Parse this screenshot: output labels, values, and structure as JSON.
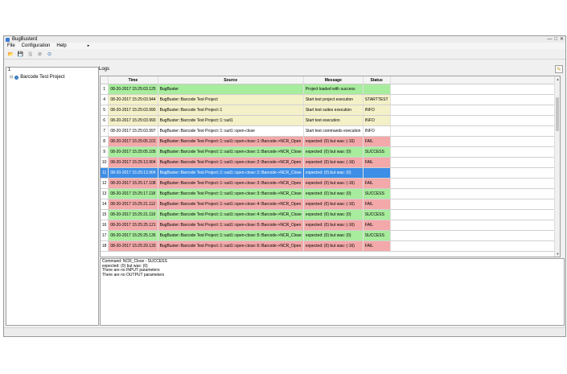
{
  "window": {
    "title": "BugBusterd",
    "controls": {
      "minimize": "—",
      "maximize": "□",
      "close": "✕"
    }
  },
  "menu": {
    "file": "File",
    "configuration": "Configuration",
    "help": "Help",
    "arrow": "▸"
  },
  "toolbar": {
    "icons": {
      "open": "📂",
      "save": "💾",
      "save_all": "🖫",
      "stop": "⊘",
      "run": "⊙"
    }
  },
  "tree": {
    "index": "1",
    "expander": "⊟",
    "project_label": "Barcode Test Project"
  },
  "logs": {
    "label": "Logs",
    "clear_icon": "✎",
    "columns": {
      "time": "Time",
      "source": "Source",
      "message": "Message",
      "status": "Status"
    },
    "rows": [
      {
        "idx": "1",
        "time": "08-20-2017 15:25:03.125",
        "source": "BugBuster",
        "message": "Project loaded with success",
        "status": "",
        "color": "green"
      },
      {
        "idx": "4",
        "time": "08-20-2017 15:25:03.944",
        "source": "BugBuster::Barcode Test Project",
        "message": "Start test project execution",
        "status": "STARTTEST",
        "color": "yellow"
      },
      {
        "idx": "5",
        "time": "08-20-2017 15:25:03.990",
        "source": "BugBuster::Barcode Test Project::1",
        "message": "Start test suites execution",
        "status": "INFO",
        "color": "yellow"
      },
      {
        "idx": "6",
        "time": "08-20-2017 15:25:03.993",
        "source": "BugBuster::Barcode Test Project::1::suit1",
        "message": "Start test execution",
        "status": "INFO",
        "color": "yellow"
      },
      {
        "idx": "7",
        "time": "08-20-2017 15:25:03.997",
        "source": "BugBuster::Barcode Test Project::1::suit1::open-close",
        "message": "Start test commands execution",
        "status": "INFO",
        "color": "white"
      },
      {
        "idx": "8",
        "time": "08-20-2017 15:25:05.101",
        "source": "BugBuster::Barcode Test Project::1::suit1::open-close::1::Barcode->NCR_Open",
        "message": "expected: (0) but was: (-16)",
        "status": "FAIL",
        "color": "red"
      },
      {
        "idx": "9",
        "time": "08-20-2017 15:25:05.105",
        "source": "BugBuster::Barcode Test Project::1::suit1::open-close::1::Barcode->NCR_Close",
        "message": "expected: (0) but was: (0)",
        "status": "SUCCESS",
        "color": "green"
      },
      {
        "idx": "10",
        "time": "08-20-2017 15:25:13.904",
        "source": "BugBuster::Barcode Test Project::1::suit1::open-close::2::Barcode->NCR_Open",
        "message": "expected: (0) but was: (-16)",
        "status": "FAIL",
        "color": "red"
      },
      {
        "idx": "11",
        "time": "08-20-2017 15:25:13.904",
        "source": "BugBuster::Barcode Test Project::1::suit1::open-close::2::Barcode->NCR_Close",
        "message": "expected: (0) but was: (0)",
        "status": "",
        "color": "selected"
      },
      {
        "idx": "12",
        "time": "08-20-2017 15:25:17.108",
        "source": "BugBuster::Barcode Test Project::1::suit1::open-close::3::Barcode->NCR_Open",
        "message": "expected: (0) but was: (-16)",
        "status": "FAIL",
        "color": "red"
      },
      {
        "idx": "13",
        "time": "08-20-2017 15:25:17.118",
        "source": "BugBuster::Barcode Test Project::1::suit1::open-close::3::Barcode->NCR_Close",
        "message": "expected: (0) but was: (0)",
        "status": "SUCCESS",
        "color": "green"
      },
      {
        "idx": "14",
        "time": "08-20-2017 15:25:21.112",
        "source": "BugBuster::Barcode Test Project::1::suit1::open-close::4::Barcode->NCR_Open",
        "message": "expected: (0) but was: (-16)",
        "status": "FAIL",
        "color": "red"
      },
      {
        "idx": "15",
        "time": "08-20-2017 15:25:21.119",
        "source": "BugBuster::Barcode Test Project::1::suit1::open-close::4::Barcode->NCR_Close",
        "message": "expected: (0) but was: (0)",
        "status": "SUCCESS",
        "color": "green"
      },
      {
        "idx": "16",
        "time": "08-20-2017 15:25:25.121",
        "source": "BugBuster::Barcode Test Project::1::suit1::open-close::5::Barcode->NCR_Open",
        "message": "expected: (0) but was: (-16)",
        "status": "FAIL",
        "color": "red"
      },
      {
        "idx": "17",
        "time": "08-20-2017 15:25:25.135",
        "source": "BugBuster::Barcode Test Project::1::suit1::open-close::5::Barcode->NCR_Close",
        "message": "expected: (0) but was: (0)",
        "status": "SUCCESS",
        "color": "green"
      },
      {
        "idx": "18",
        "time": "08-20-2017 15:25:29.133",
        "source": "BugBuster::Barcode Test Project::1::suit1::open-close::6::Barcode->NCR_Open",
        "message": "expected: (0) but was: (-16)",
        "status": "FAIL",
        "color": "red"
      }
    ]
  },
  "scrollbar": {
    "up": "▲",
    "down": "▼"
  },
  "details": {
    "lines": [
      "Command: NCR_Close - SUCCESS",
      "expected: (0) but was: (0)",
      "There are no INPUT parameters",
      "There are no OUTPUT parameters"
    ]
  }
}
